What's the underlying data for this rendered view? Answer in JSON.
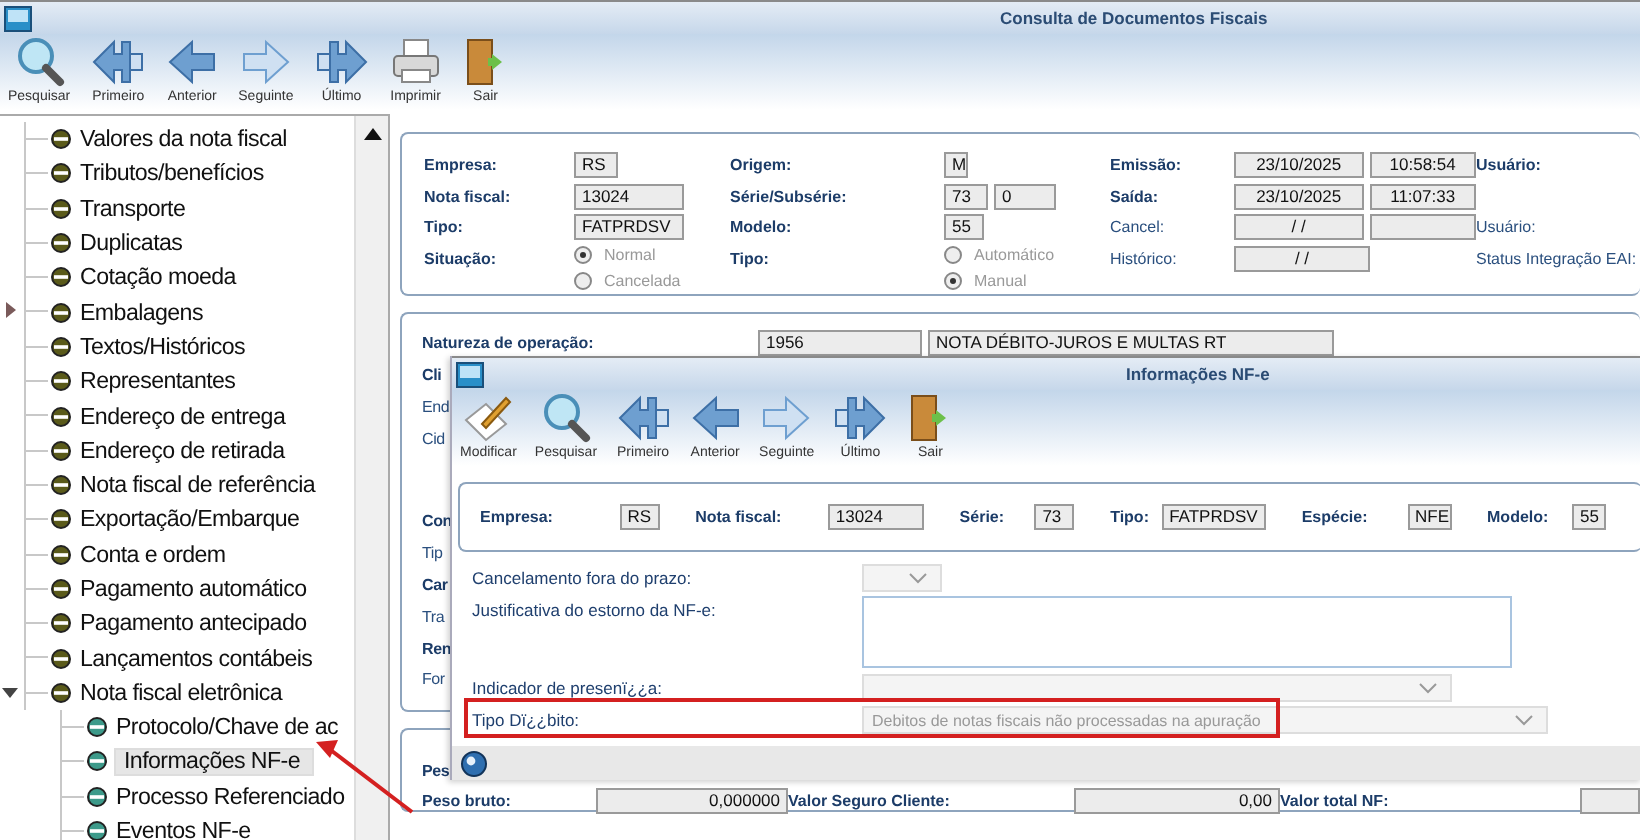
{
  "window": {
    "title": "Consulta de Documentos Fiscais"
  },
  "toolbar": [
    {
      "label": "Pesquisar",
      "kind": "search"
    },
    {
      "label": "Primeiro",
      "kind": "first"
    },
    {
      "label": "Anterior",
      "kind": "previous"
    },
    {
      "label": "Seguinte",
      "kind": "next"
    },
    {
      "label": "Último",
      "kind": "last"
    },
    {
      "label": "Imprimir",
      "kind": "print"
    },
    {
      "label": "Sair",
      "kind": "exit"
    }
  ],
  "tree": {
    "items": [
      {
        "label": "Valores da nota fiscal",
        "selected": false
      },
      {
        "label": "Tributos/benefícios",
        "selected": false
      },
      {
        "label": "Transporte",
        "selected": false
      },
      {
        "label": "Duplicatas",
        "selected": false
      },
      {
        "label": "Cotação moeda",
        "selected": false
      },
      {
        "label": "Embalagens",
        "selected": false,
        "expanded": false
      },
      {
        "label": "Textos/Históricos",
        "selected": false
      },
      {
        "label": "Representantes",
        "selected": false
      },
      {
        "label": "Endereço de entrega",
        "selected": false
      },
      {
        "label": "Endereço de retirada",
        "selected": false
      },
      {
        "label": "Nota fiscal de referência",
        "selected": false
      },
      {
        "label": "Exportação/Embarque",
        "selected": false
      },
      {
        "label": "Conta e ordem",
        "selected": false
      },
      {
        "label": "Pagamento automático",
        "selected": false
      },
      {
        "label": "Pagamento antecipado",
        "selected": false
      },
      {
        "label": "Lançamentos contábeis",
        "selected": false
      },
      {
        "label": "Nota fiscal eletrônica",
        "selected": false,
        "expanded": true,
        "children": [
          {
            "label": "Protocolo/Chave de ac",
            "selected": false
          },
          {
            "label": "Informações NF-e",
            "selected": true
          },
          {
            "label": "Processo Referenciado",
            "selected": false
          },
          {
            "label": "Eventos NF-e",
            "selected": false
          }
        ]
      }
    ]
  },
  "header": {
    "rows": [
      [
        {
          "kind": "label",
          "text": "Empresa:",
          "bold": true
        },
        {
          "kind": "inputs",
          "values": [
            "RS"
          ]
        },
        {
          "kind": "label",
          "text": "Origem:",
          "bold": true
        },
        {
          "kind": "inputs",
          "values": [
            "M"
          ]
        },
        {
          "kind": "label",
          "text": "Emissão:",
          "bold": true
        },
        {
          "kind": "inputs",
          "values": [
            "23/10/2025",
            "10:58:54"
          ]
        },
        {
          "kind": "label",
          "text": "Usuário:",
          "bold": true
        }
      ],
      [
        {
          "kind": "label",
          "text": "Nota fiscal:",
          "bold": true
        },
        {
          "kind": "inputs",
          "values": [
            "13024"
          ]
        },
        {
          "kind": "label",
          "text": "Série/Subsérie:",
          "bold": true
        },
        {
          "kind": "inputs",
          "values": [
            "73",
            "0"
          ]
        },
        {
          "kind": "label",
          "text": "Saída:",
          "bold": true
        },
        {
          "kind": "inputs",
          "values": [
            "23/10/2025",
            "11:07:33"
          ]
        }
      ],
      [
        {
          "kind": "label",
          "text": "Tipo:",
          "bold": true
        },
        {
          "kind": "inputs",
          "values": [
            "FATPRDSV"
          ]
        },
        {
          "kind": "label",
          "text": "Modelo:",
          "bold": true
        },
        {
          "kind": "inputs",
          "values": [
            "55"
          ]
        },
        {
          "kind": "label",
          "text": "Cancel:",
          "bold": false
        },
        {
          "kind": "inputs",
          "values": [
            "/ /"
          ],
          "empty_field": true
        },
        {
          "kind": "label",
          "text": "Usuário:",
          "bold": false
        }
      ],
      [
        {
          "kind": "label",
          "text": "Situação:",
          "bold": true
        },
        {
          "kind": "radio",
          "options": [
            {
              "label": "Normal",
              "selected": true
            },
            {
              "label": "Cancelada",
              "selected": false
            }
          ]
        },
        {
          "kind": "label",
          "text": "Tipo:",
          "bold": true
        },
        {
          "kind": "radio",
          "options": [
            {
              "label": "Automático",
              "selected": false
            },
            {
              "label": "Manual",
              "selected": true
            }
          ]
        },
        {
          "kind": "label",
          "text": "Histórico:",
          "bold": false
        },
        {
          "kind": "inputs",
          "values": [
            "/ /"
          ]
        },
        {
          "kind": "label",
          "text": "Status Integração EAI:",
          "bold": false
        }
      ]
    ]
  },
  "operation": {
    "label": "Natureza de operação:",
    "values": [
      "1956",
      "NOTA DÉBITO-JUROS E MULTAS RT"
    ],
    "cut_labels": [
      [
        {
          "text": "Cli",
          "bold": true
        },
        {
          "text": "End",
          "bold": false
        },
        {
          "text": "Cid",
          "bold": false
        }
      ],
      [
        {
          "text": "Con",
          "bold": true
        },
        {
          "text": "Tip",
          "bold": false
        },
        {
          "text": "Car",
          "bold": true
        },
        {
          "text": "Tra",
          "bold": false
        },
        {
          "text": "Ren",
          "bold": true
        },
        {
          "text": "For",
          "bold": false
        }
      ]
    ]
  },
  "totals": {
    "cut_label": "Pes",
    "fields": [
      {
        "label": "Peso bruto:",
        "value": "0,000000"
      },
      {
        "label": "Valor Seguro Cliente:",
        "value": "0,00"
      },
      {
        "label": "Valor total NF:"
      }
    ]
  },
  "dialog": {
    "title": "Informações NF-e",
    "toolbar": [
      {
        "label": "Modificar",
        "kind": "edit"
      },
      {
        "label": "Pesquisar",
        "kind": "search"
      },
      {
        "label": "Primeiro",
        "kind": "first"
      },
      {
        "label": "Anterior",
        "kind": "previous"
      },
      {
        "label": "Seguinte",
        "kind": "next"
      },
      {
        "label": "Último",
        "kind": "last"
      },
      {
        "label": "Sair",
        "kind": "exit"
      }
    ],
    "fields": [
      {
        "label": "Empresa:",
        "value": "RS"
      },
      {
        "label": "Nota fiscal:",
        "value": "13024"
      },
      {
        "label": "Série:",
        "value": "73"
      },
      {
        "label": "Tipo:",
        "value": "FATPRDSV"
      },
      {
        "label": "Espécie:",
        "value": "NFE"
      },
      {
        "label": "Modelo:",
        "value": "55"
      }
    ],
    "form": [
      {
        "kind": "select",
        "label": "Cancelamento fora do prazo:",
        "highlighted": false
      },
      {
        "kind": "textarea",
        "label": "Justificativa do estorno da NF-e:",
        "highlighted": false
      },
      {
        "kind": "select",
        "label": "Indicador de presenï¿¿a:",
        "highlighted": false
      },
      {
        "kind": "select",
        "label": "Tipo Dï¿¿bito:",
        "value": "Debitos de notas fiscais não processadas na apuração",
        "highlighted": true
      }
    ]
  }
}
